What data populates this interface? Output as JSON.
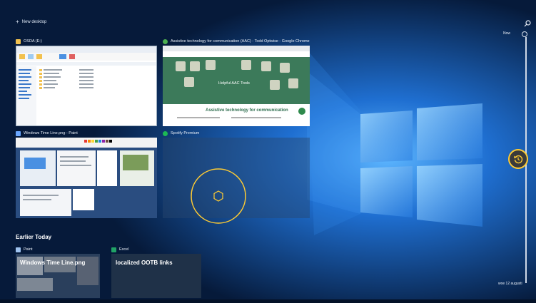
{
  "header": {
    "new_desktop_label": "New desktop",
    "plus_glyph": "+"
  },
  "icons": {
    "search": "search-icon",
    "restore": "history-icon"
  },
  "windows": [
    {
      "title": "OSDA (E:)",
      "app_icon": "folder-icon",
      "icon_color": "#f2c14e"
    },
    {
      "title": "Assistive technology for communication (AAC) - Todd Optwise - Google Chrome",
      "app_icon": "chrome-icon",
      "icon_color": "#4caf50"
    },
    {
      "title": "Windows Time Line.png - Paint",
      "app_icon": "paint-icon",
      "icon_color": "#6aa7ff"
    },
    {
      "title": "Spotify Premium",
      "app_icon": "spotify-icon",
      "icon_color": "#1db954"
    }
  ],
  "chrome_page": {
    "overlay_text": "Helpful AAC Tools",
    "heading": "Assistive technology for communication"
  },
  "earlier": {
    "heading": "Earlier Today",
    "activities": [
      {
        "app": "Paint",
        "title": "Windows Time Line.png",
        "app_icon": "paint-icon"
      },
      {
        "app": "Excel",
        "title": "localized OOTB links",
        "app_icon": "excel-icon"
      }
    ]
  },
  "timeline": {
    "now_label": "Now",
    "date_label": "woe 12 augusti"
  },
  "accent_colors": {
    "cursor": "#ffcc33",
    "windows_blue": "#1f6fd1"
  }
}
